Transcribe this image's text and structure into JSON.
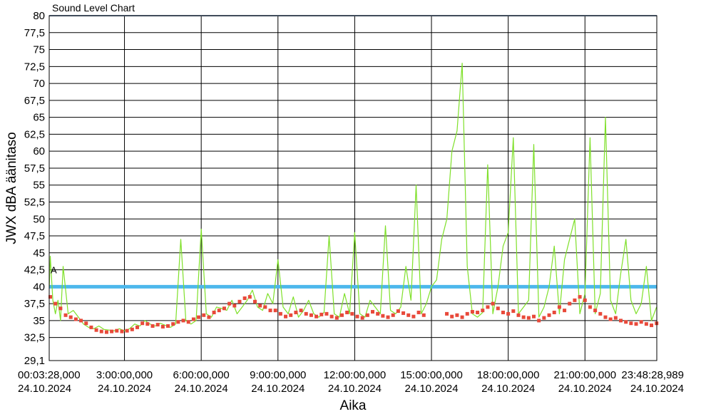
{
  "chart_data": {
    "type": "line",
    "title": "Sound Level Chart",
    "xlabel": "Aika",
    "ylabel": "JWX dBA äänitaso",
    "ylim": [
      29.1,
      80
    ],
    "yticks": [
      29.1,
      32.5,
      35,
      37.5,
      40,
      42.5,
      45,
      47.5,
      50,
      52.5,
      55,
      57.5,
      60,
      62.5,
      65,
      67.5,
      70,
      72.5,
      75,
      77.5,
      80
    ],
    "ytick_labels": [
      "29,1",
      "32,5",
      "35",
      "37,5",
      "40",
      "42,5",
      "45",
      "47,5",
      "50",
      "52,5",
      "55",
      "57,5",
      "60",
      "62,5",
      "65",
      "67,5",
      "70",
      "72,5",
      "75",
      "77,5",
      "80"
    ],
    "xlim": [
      "2024-10-24T00:03:28",
      "2024-10-24T23:48:28.989"
    ],
    "xticks": [
      {
        "time": "00:03:28,000",
        "date": "24.10.2024",
        "hours": 0.0578
      },
      {
        "time": "3:00:00,000",
        "date": "24.10.2024",
        "hours": 3
      },
      {
        "time": "6:00:00,000",
        "date": "24.10.2024",
        "hours": 6
      },
      {
        "time": "9:00:00,000",
        "date": "24.10.2024",
        "hours": 9
      },
      {
        "time": "12:00:00,000",
        "date": "24.10.2024",
        "hours": 12
      },
      {
        "time": "15:00:00,000",
        "date": "24.10.2024",
        "hours": 15
      },
      {
        "time": "18:00:00,000",
        "date": "24.10.2024",
        "hours": 18
      },
      {
        "time": "21:00:00,000",
        "date": "24.10.2024",
        "hours": 21
      },
      {
        "time": "23:48:28,989",
        "date": "24.10.2024",
        "hours": 23.808
      }
    ],
    "grid": true,
    "threshold_lines": [
      {
        "value": 40,
        "color": "#4db8ec"
      },
      {
        "value": 80,
        "color": "#7f96b3"
      }
    ],
    "annotations": [
      {
        "text": "A",
        "x_hours": 0.0578,
        "y": 42.5
      }
    ],
    "series": [
      {
        "kind": "line",
        "color": "#7fe02a",
        "x_hours": [
          0.06,
          0.1,
          0.2,
          0.3,
          0.4,
          0.5,
          0.6,
          0.8,
          1.0,
          1.2,
          1.4,
          1.6,
          1.8,
          2.0,
          2.2,
          2.4,
          2.6,
          2.8,
          3.0,
          3.2,
          3.4,
          3.6,
          3.8,
          4.0,
          4.2,
          4.4,
          4.6,
          4.8,
          5.0,
          5.2,
          5.4,
          5.6,
          5.8,
          6.0,
          6.2,
          6.4,
          6.6,
          6.8,
          7.0,
          7.2,
          7.4,
          7.6,
          7.8,
          8.0,
          8.2,
          8.4,
          8.6,
          8.8,
          9.0,
          9.2,
          9.4,
          9.6,
          9.8,
          10.0,
          10.2,
          10.4,
          10.6,
          10.8,
          11.0,
          11.2,
          11.4,
          11.6,
          11.8,
          12.0,
          12.2,
          12.4,
          12.6,
          12.8,
          13.0,
          13.2,
          13.4,
          13.6,
          13.8,
          14.0,
          14.2,
          14.4,
          14.6,
          14.8,
          15.0,
          15.2,
          15.4,
          15.6,
          15.8,
          16.0,
          16.2,
          16.4,
          16.6,
          16.8,
          17.0,
          17.2,
          17.4,
          17.6,
          17.8,
          18.0,
          18.2,
          18.4,
          18.6,
          18.8,
          19.0,
          19.2,
          19.4,
          19.6,
          19.8,
          20.0,
          20.2,
          20.4,
          20.6,
          20.8,
          21.0,
          21.2,
          21.4,
          21.6,
          21.8,
          22.0,
          22.2,
          22.4,
          22.6,
          22.8,
          23.0,
          23.2,
          23.4,
          23.6,
          23.8
        ],
        "values": [
          40,
          44.5,
          38,
          36,
          38,
          35,
          43,
          36,
          36.5,
          35.5,
          34.5,
          34,
          33.8,
          34.2,
          33.7,
          33.6,
          33.5,
          33.8,
          33.5,
          33.8,
          34.5,
          34.2,
          35,
          34.5,
          34.2,
          34.6,
          34.3,
          34,
          34.5,
          47,
          35,
          34.5,
          35,
          48.5,
          36,
          35.5,
          37,
          36.8,
          36.5,
          38,
          36,
          37,
          38,
          39.5,
          37,
          36.5,
          39,
          37.5,
          44,
          37,
          36,
          38.5,
          35.5,
          36.5,
          38,
          36,
          35.5,
          36.2,
          47.5,
          36,
          35.5,
          39,
          36,
          48,
          36,
          35.5,
          38,
          37,
          36,
          49,
          36.5,
          36,
          37,
          43,
          38,
          55,
          36,
          37.5,
          40,
          41,
          47,
          50,
          60,
          63,
          73,
          43,
          36,
          35.5,
          36.2,
          58,
          36,
          40,
          46,
          48,
          62,
          36,
          37,
          38,
          61,
          35.5,
          37,
          40,
          46,
          36,
          44,
          47,
          50,
          36,
          39,
          62,
          36,
          39,
          65,
          38,
          36,
          42,
          47,
          38,
          36,
          37.5,
          43,
          35,
          37,
          35.5,
          36,
          35,
          34.5,
          35.5,
          42
        ]
      },
      {
        "kind": "markers",
        "color": "#e8493a",
        "x_hours": [
          0.1,
          0.3,
          0.5,
          0.7,
          0.9,
          1.1,
          1.3,
          1.5,
          1.7,
          1.9,
          2.1,
          2.3,
          2.5,
          2.7,
          2.9,
          3.1,
          3.3,
          3.5,
          3.7,
          3.9,
          4.1,
          4.3,
          4.5,
          4.7,
          4.9,
          5.1,
          5.3,
          5.5,
          5.7,
          5.9,
          6.1,
          6.3,
          6.5,
          6.7,
          6.9,
          7.1,
          7.3,
          7.5,
          7.7,
          7.9,
          8.1,
          8.3,
          8.5,
          8.7,
          8.9,
          9.1,
          9.3,
          9.5,
          9.7,
          9.9,
          10.1,
          10.3,
          10.5,
          10.7,
          10.9,
          11.1,
          11.3,
          11.5,
          11.7,
          11.9,
          12.1,
          12.3,
          12.5,
          12.7,
          12.9,
          13.1,
          13.3,
          13.5,
          13.7,
          13.9,
          14.1,
          14.3,
          14.5,
          14.7,
          15.6,
          15.8,
          16.0,
          16.2,
          16.4,
          16.6,
          16.8,
          17.0,
          17.2,
          17.4,
          17.6,
          17.8,
          18.0,
          18.2,
          18.4,
          18.6,
          18.8,
          19.0,
          19.2,
          19.4,
          19.6,
          19.8,
          20.0,
          20.2,
          20.4,
          20.6,
          20.8,
          21.0,
          21.2,
          21.4,
          21.6,
          21.8,
          22.0,
          22.2,
          22.4,
          22.6,
          22.8,
          23.0,
          23.2,
          23.4,
          23.6,
          23.8
        ],
        "values": [
          38.5,
          37.5,
          36.8,
          35.8,
          35.5,
          35.2,
          35,
          34.6,
          34,
          33.6,
          33.4,
          33.3,
          33.4,
          33.5,
          33.4,
          33.5,
          33.7,
          34,
          34.6,
          34.5,
          34.2,
          34.4,
          34.1,
          34.2,
          34.5,
          34.8,
          35,
          34.8,
          35.2,
          35.5,
          35.8,
          35.5,
          36.2,
          36.5,
          36.8,
          37.5,
          37.2,
          37.8,
          38.3,
          38.5,
          37.8,
          37.2,
          37,
          36.5,
          36.5,
          36,
          35.6,
          35.8,
          36.2,
          36.5,
          36,
          35.8,
          35.6,
          35.9,
          36,
          35.6,
          35.4,
          35.8,
          36.2,
          36,
          35.6,
          35.4,
          35.8,
          36.3,
          36,
          35.7,
          35.5,
          35.8,
          36.4,
          36.1,
          35.8,
          35.6,
          36.2,
          35.8,
          36,
          35.6,
          35.8,
          35.5,
          36,
          36.3,
          36.2,
          36.5,
          37,
          37.5,
          36.8,
          36.2,
          36,
          36.4,
          35.8,
          35.5,
          35.4,
          35.6,
          35,
          35.4,
          35.8,
          36.2,
          37,
          36.5,
          37.5,
          38,
          38.5,
          38,
          37,
          36.5,
          36,
          35.5,
          35.2,
          35.4,
          35,
          34.8,
          34.6,
          34.5,
          34.8,
          34.5,
          34.3,
          34.6
        ]
      }
    ]
  }
}
